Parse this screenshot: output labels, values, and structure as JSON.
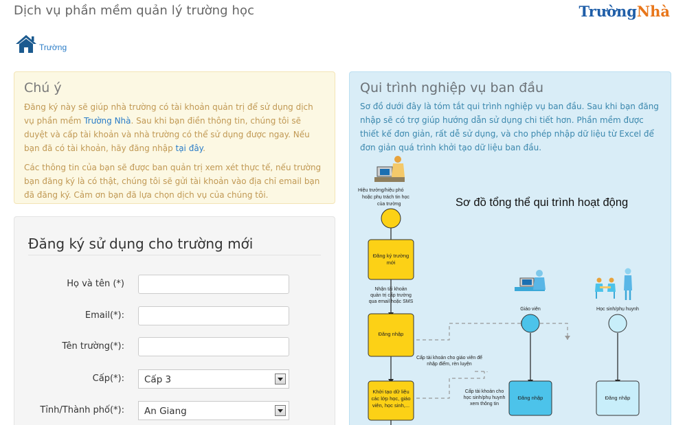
{
  "header": {
    "title": "Dịch vụ phần mềm quản lý trường học",
    "logo_part1": "Trường",
    "logo_part2": "Nhà"
  },
  "breadcrumb": {
    "label": "Trường"
  },
  "notice": {
    "heading": "Chú ý",
    "p1_before": "Đăng ký này sẽ giúp nhà trường có tài khoản quản trị để sử dụng dịch vụ phần mềm ",
    "p1_link": "Trường Nhà",
    "p1_mid": ". Sau khi bạn điền thông tin, chúng tôi sẽ duyệt và cấp tài khoản và nhà trường có thể sử dụng được ngay. Nếu bạn đã có tài khoản, hãy đăng nhập ",
    "p1_link2": "tại đây",
    "p1_end": ".",
    "p2": "Các thông tin của bạn sẽ được ban quản trị xem xét thực tế, nếu trường bạn đăng ký là có thật, chúng tôi sẽ gửi tài khoản vào địa chỉ email bạn đã đăng ký. Cảm ơn bạn đã lựa chọn dịch vụ của chúng tôi."
  },
  "form": {
    "heading": "Đăng ký sử dụng cho trường mới",
    "fields": {
      "name_label": "Họ và tên (*)",
      "name_value": "",
      "email_label": "Email(*):",
      "email_value": "",
      "school_label": "Tên trường(*):",
      "school_value": "",
      "level_label": "Cấp(*):",
      "level_value": "Cấp 3",
      "province_label": "Tỉnh/Thành phố(*):",
      "province_value": "An Giang"
    }
  },
  "process": {
    "heading": "Qui trình nghiệp vụ ban đầu",
    "description": "Sơ đồ dưới đây là tóm tắt qui trình nghiệp vụ ban đầu. Sau khi bạn đăng nhập sẽ có trợ giúp hướng dẫn sử dụng chi tiết hơn. Phần mềm được thiết kế đơn giản, rất dễ sử dụng, và cho phép nhập dữ liệu từ Excel để đơn giản quá trình khởi tạo dữ liệu ban đầu.",
    "diagram": {
      "title": "Sơ đồ tổng thể qui trình hoạt động",
      "actor_principal_l1": "Hiệu trưởng/hiệu phó",
      "actor_principal_l2": "hoặc phụ trách tin học",
      "actor_principal_l3": "của trường",
      "step_register_l1": "Đăng ký trường",
      "step_register_l2": "mới",
      "receive_l1": "Nhận tài khoản",
      "receive_l2": "quản trị cấp trường",
      "receive_l3": "qua email hoặc SMS",
      "step_login": "Đăng nhập",
      "step_init_l1": "Khởi tạo dữ liệu",
      "step_init_l2": "các lớp học, giáo",
      "step_init_l3": "viên, học sinh,...",
      "actor_teacher": "Giáo viên",
      "actor_student": "Học sinh/phụ huynh",
      "note_teacher_l1": "Cấp tài khoản cho giáo viên để",
      "note_teacher_l2": "nhập điểm, rèn luyện",
      "note_student_l1": "Cấp tài khoản cho",
      "note_student_l2": "học sinh/phụ huynh",
      "note_student_l3": "xem thông tin",
      "teacher_login": "Đăng nhập",
      "student_login": "Đăng nhập"
    }
  },
  "colors": {
    "notice_bg": "#fcf8e3",
    "notice_text": "#c09853",
    "link": "#2a7cc7",
    "process_bg": "#d9edf7",
    "process_text": "#3a87ad",
    "flow_yellow": "#fcd116",
    "flow_cyan": "#4cc3ea",
    "flow_light_cyan": "#c8eefa"
  }
}
